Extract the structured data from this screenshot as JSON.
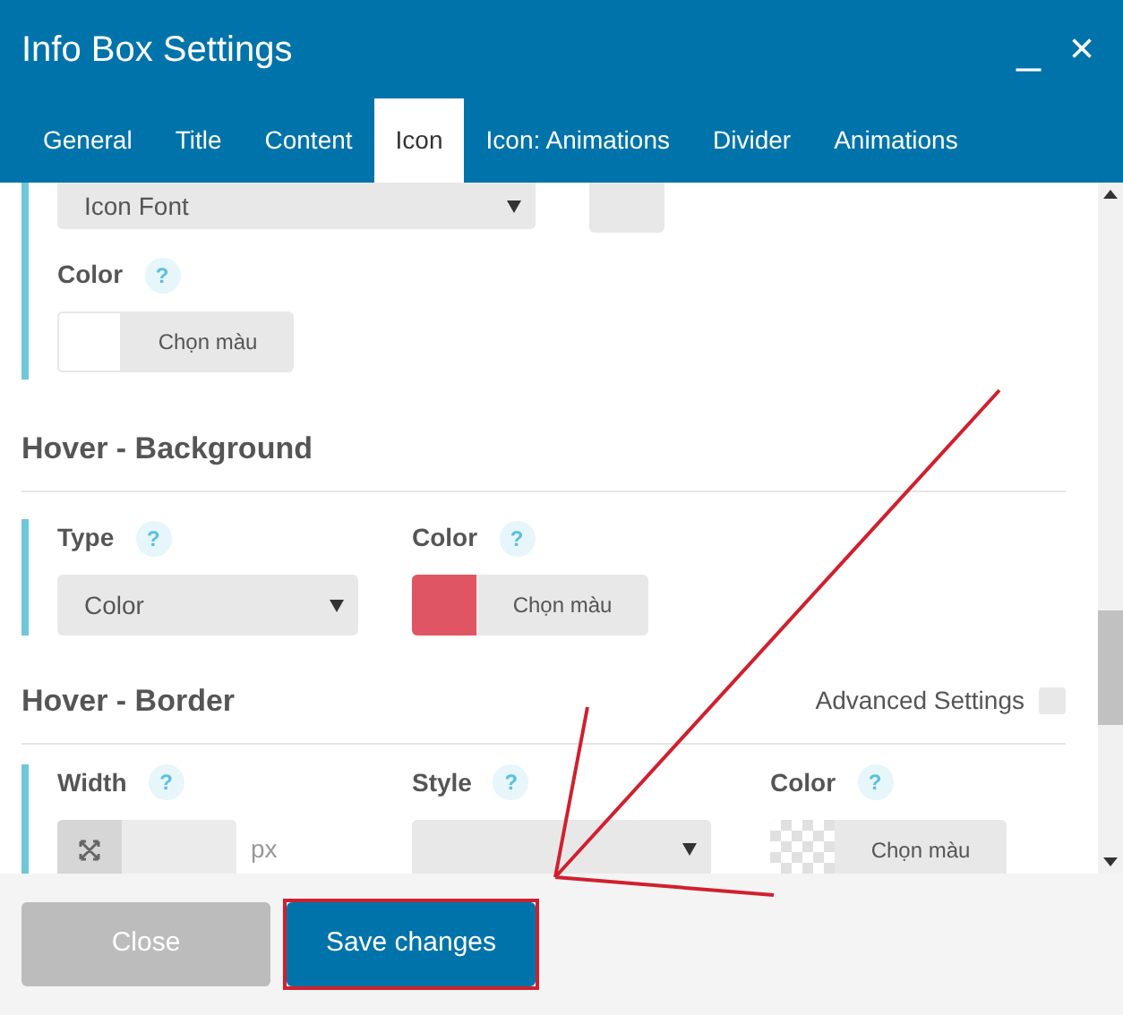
{
  "window": {
    "title": "Info Box Settings",
    "controls": [
      "_",
      "×"
    ]
  },
  "tabs": [
    {
      "label": "General",
      "selected": false
    },
    {
      "label": "Title",
      "selected": false
    },
    {
      "label": "Content",
      "selected": false
    },
    {
      "label": "Icon",
      "selected": true
    },
    {
      "label": "Icon: Animations",
      "selected": false
    },
    {
      "label": "Divider",
      "selected": false
    },
    {
      "label": "Animations",
      "selected": false
    }
  ],
  "icon_section": {
    "select_value": "Icon Font",
    "color_label": "Color",
    "help": "?",
    "color_button": "Chọn màu"
  },
  "hover_background": {
    "title": "Hover - Background",
    "type_label": "Type",
    "type_help": "?",
    "type_value": "Color",
    "color_label": "Color",
    "color_help": "?",
    "color": "#e05563",
    "color_button": "Chọn màu"
  },
  "hover_border": {
    "title": "Hover - Border",
    "advanced_label": "Advanced Settings",
    "advanced_checked": false,
    "width_label": "Width",
    "width_help": "?",
    "unit": "px",
    "style_label": "Style",
    "style_help": "?",
    "color_label": "Color",
    "color_help": "?",
    "color_button": "Chọn màu"
  },
  "footer": {
    "buttons": [
      {
        "label": "Close",
        "kind": "secondary"
      },
      {
        "label": "Save changes",
        "kind": "primary",
        "highlighted": true
      }
    ]
  }
}
